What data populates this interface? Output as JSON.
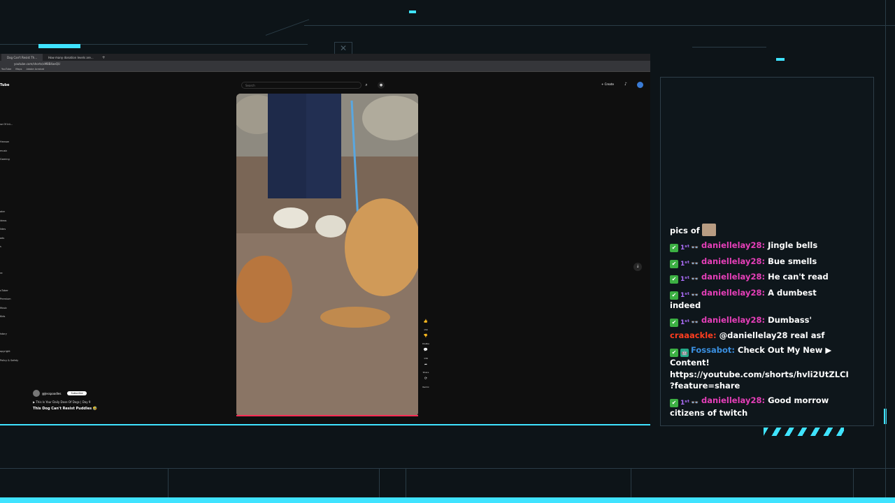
{
  "browser": {
    "tabs": [
      "Dog Can't Resist Th...",
      "How many donation levels are..."
    ],
    "url": "youtube.com/shorts/xM8B4aeQU",
    "bookmarks": [
      "YouTube",
      "Maps",
      "Adobe Acrobat"
    ]
  },
  "youtube": {
    "logo": "Tube",
    "search_placeholder": "Search",
    "create_label": "Create",
    "sidebar_items": [
      "",
      "",
      "se Of Int...",
      "",
      "Hanson",
      "music",
      "Gaming",
      "",
      "",
      "",
      "",
      "",
      "ater",
      "ideos",
      "lides",
      "ads",
      "s",
      "",
      "",
      "re",
      "",
      "uTuber",
      "Premium",
      "Music",
      "Kids",
      "",
      "istory",
      "",
      "opyright",
      "Policy & Safety"
    ],
    "channel_name": "@Jesspoodles",
    "subscribe_label": "Subscribe",
    "playlist_label": "This Is Your Daily Dose Of Dogs | Day 9",
    "video_title": "This Dog Can't Resist Puddles 🤣",
    "action_counts": [
      "15K",
      "Dislike",
      "136",
      "Share",
      "Remix"
    ]
  },
  "chat": {
    "rows": [
      {
        "type": "text",
        "text": "pics of"
      },
      {
        "type": "msg",
        "user": "daniellelay28:",
        "user_style": "pink",
        "badges": [
          "check",
          "one",
          "glasses"
        ],
        "text": "Jingle bells"
      },
      {
        "type": "msg",
        "user": "daniellelay28:",
        "user_style": "pink",
        "badges": [
          "check",
          "one",
          "glasses"
        ],
        "text": "Bue smells"
      },
      {
        "type": "msg",
        "user": "daniellelay28:",
        "user_style": "pink",
        "badges": [
          "check",
          "one",
          "glasses"
        ],
        "text": "He can't read"
      },
      {
        "type": "msg",
        "user": "daniellelay28:",
        "user_style": "pink",
        "badges": [
          "check",
          "one",
          "glasses"
        ],
        "text": "A dumbest indeed"
      },
      {
        "type": "msg",
        "user": "daniellelay28:",
        "user_style": "pink",
        "badges": [
          "check",
          "one",
          "glasses"
        ],
        "text": "Dumbass'"
      },
      {
        "type": "msg",
        "user": "craaackle:",
        "user_style": "red",
        "badges": [],
        "text": "@daniellelay28 real asf"
      },
      {
        "type": "msg",
        "user": "Fossabot:",
        "user_style": "blue",
        "badges": [
          "check",
          "bot"
        ],
        "text": "Check Out My New ▶ Content! https://youtube.com/shorts/hvli2UtZLCI ?feature=share"
      },
      {
        "type": "msg",
        "user": "daniellelay28:",
        "user_style": "pink",
        "badges": [
          "check",
          "one",
          "glasses"
        ],
        "text": "Good morrow citizens of twitch"
      }
    ]
  },
  "colors": {
    "accent": "#3fe3ff",
    "pink_user": "#e53fb8",
    "red_user": "#ff3d1f",
    "blue_user": "#3a8fe0"
  }
}
